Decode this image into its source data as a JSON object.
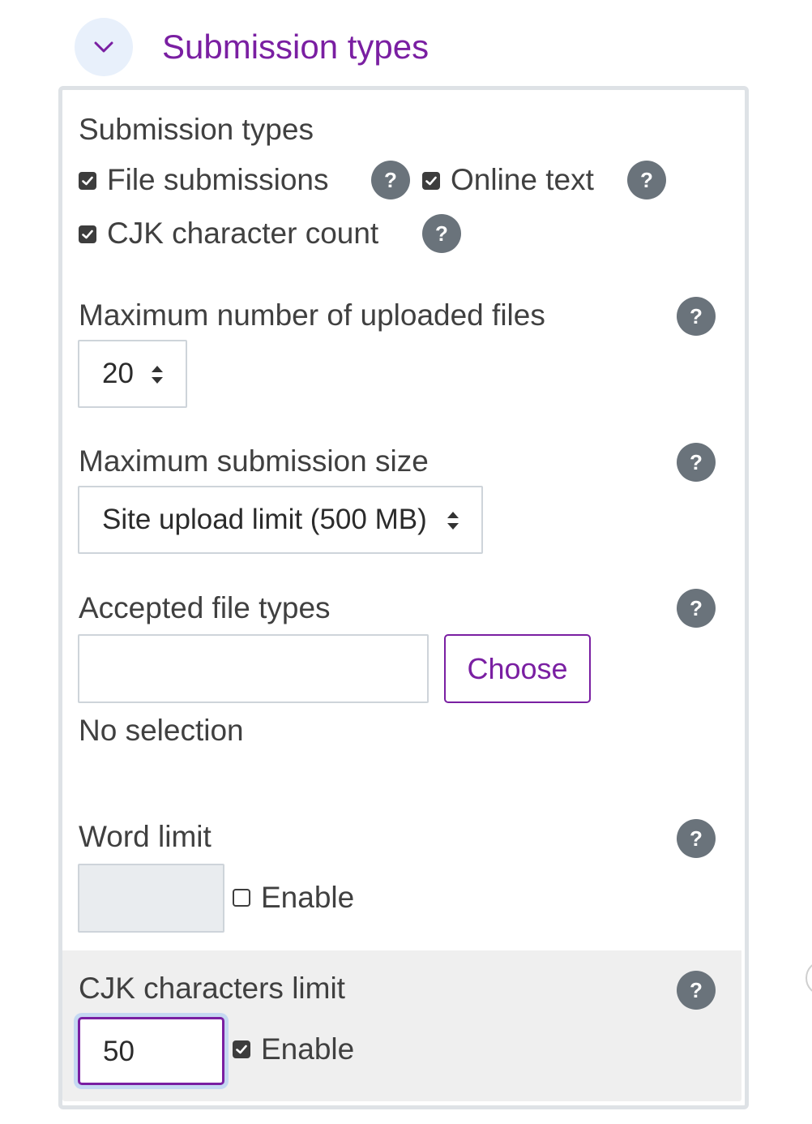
{
  "section": {
    "title": "Submission types"
  },
  "panel": {
    "heading": "Submission types",
    "submission_types": [
      {
        "label": "File submissions",
        "checked": true
      },
      {
        "label": "Online text",
        "checked": true
      },
      {
        "label": "CJK character count",
        "checked": true
      }
    ],
    "max_files": {
      "label": "Maximum number of uploaded files",
      "value": "20"
    },
    "max_size": {
      "label": "Maximum submission size",
      "value": "Site upload limit (500 MB)"
    },
    "file_types": {
      "label": "Accepted file types",
      "value": "",
      "button": "Choose",
      "status": "No selection"
    },
    "word_limit": {
      "label": "Word limit",
      "value": "",
      "enable_label": "Enable",
      "enabled": false
    },
    "cjk_limit": {
      "label": "CJK characters limit",
      "value": "50",
      "enable_label": "Enable",
      "enabled": true
    },
    "help_glyph": "?"
  },
  "icons": {
    "collapse": "chevron-down-icon",
    "help": "question-circle-icon",
    "select_arrows": "sort-updown-icon",
    "checkbox": "checkbox-icon"
  },
  "colors": {
    "accent": "#7a1fa2",
    "help_bg": "#6a737b",
    "collapse_bg": "#e8f0fb",
    "panel_border": "#dee2e6",
    "focus_ring": "#c5d8f2"
  }
}
